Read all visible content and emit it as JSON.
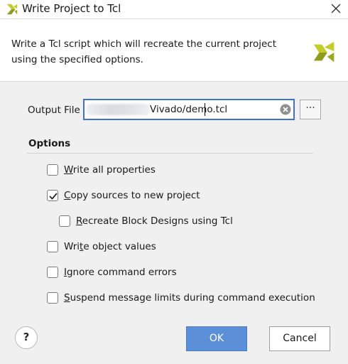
{
  "window": {
    "title": "Write Project to Tcl",
    "title_icon": "vivado-logo-icon",
    "close_icon": "close-icon"
  },
  "header": {
    "description": "Write a Tcl script which will recreate the current project using the specified options.",
    "logo": "vivado-logo-icon"
  },
  "output_file": {
    "label": "Output File",
    "value": "Vivado/demo.tcl",
    "clear_icon": "clear-icon",
    "browse_label": "···"
  },
  "options": {
    "title": "Options",
    "items": [
      {
        "pre": "",
        "mn": "W",
        "post": "rite all properties",
        "checked": false
      },
      {
        "pre": "",
        "mn": "C",
        "post": "opy sources to new project",
        "checked": true
      },
      {
        "pre": "",
        "mn": "R",
        "post": "ecreate Block Designs using Tcl",
        "checked": false
      },
      {
        "pre": "Wri",
        "mn": "t",
        "post": "e object values",
        "checked": false
      },
      {
        "pre": "",
        "mn": "I",
        "post": "gnore command errors",
        "checked": false
      },
      {
        "pre": "",
        "mn": "S",
        "post": "uspend message limits during command execution",
        "checked": false
      }
    ]
  },
  "buttons": {
    "help": "?",
    "ok": "OK",
    "cancel": "Cancel"
  },
  "colors": {
    "accent": "#5b8fd8",
    "input_border": "#3d73c8",
    "logo_yellow": "#c4cc2a",
    "logo_green": "#8e9b1c"
  }
}
